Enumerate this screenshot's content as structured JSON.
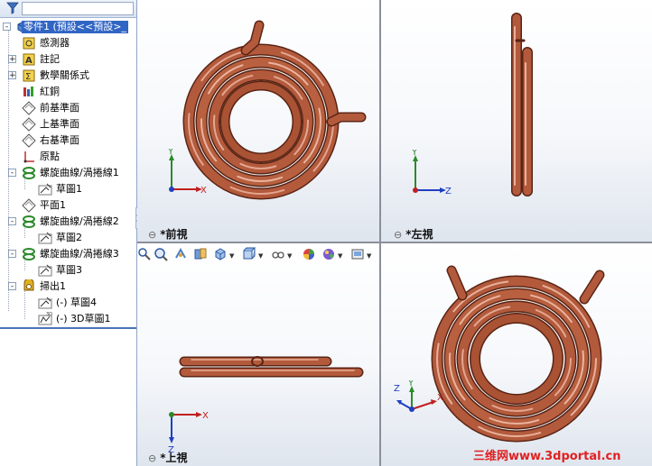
{
  "feature_tree": {
    "items": [
      {
        "label": "零件1 (預設<<預設>_",
        "icon": "part-icon"
      },
      {
        "label": "感測器",
        "icon": "sensor-icon"
      },
      {
        "label": "註記",
        "icon": "annotation-icon"
      },
      {
        "label": "數學關係式",
        "icon": "equation-icon"
      },
      {
        "label": "紅銅",
        "icon": "material-icon"
      },
      {
        "label": "前基準面",
        "icon": "plane-icon"
      },
      {
        "label": "上基準面",
        "icon": "plane-icon"
      },
      {
        "label": "右基準面",
        "icon": "plane-icon"
      },
      {
        "label": "原點",
        "icon": "origin-icon"
      },
      {
        "label": "螺旋曲線/渦捲線1",
        "icon": "helix-icon"
      },
      {
        "label": "草圖1",
        "icon": "sketch-icon"
      },
      {
        "label": "平面1",
        "icon": "plane-icon"
      },
      {
        "label": "螺旋曲線/渦捲線2",
        "icon": "helix-icon"
      },
      {
        "label": "草圖2",
        "icon": "sketch-icon"
      },
      {
        "label": "螺旋曲線/渦捲線3",
        "icon": "helix-icon"
      },
      {
        "label": "草圖3",
        "icon": "sketch-icon"
      },
      {
        "label": "掃出1",
        "icon": "sweep-icon"
      },
      {
        "label": "(-) 草圖4",
        "icon": "sketch-icon"
      },
      {
        "label": "(-) 3D草圖1",
        "icon": "3d-sketch-icon"
      }
    ]
  },
  "viewports": {
    "front": {
      "label": "*前視"
    },
    "left": {
      "label": "*左視"
    },
    "top": {
      "label": "*上視"
    },
    "iso": {
      "label": ""
    }
  },
  "axes": {
    "x": "X",
    "y": "Y",
    "z": "Z"
  },
  "watermark": "三维网www.3dportal.cn",
  "colors": {
    "copper": "#b35a3c",
    "copper_dark": "#6e2a18",
    "copper_light": "#e8b09a",
    "selection": "#3165c4"
  }
}
